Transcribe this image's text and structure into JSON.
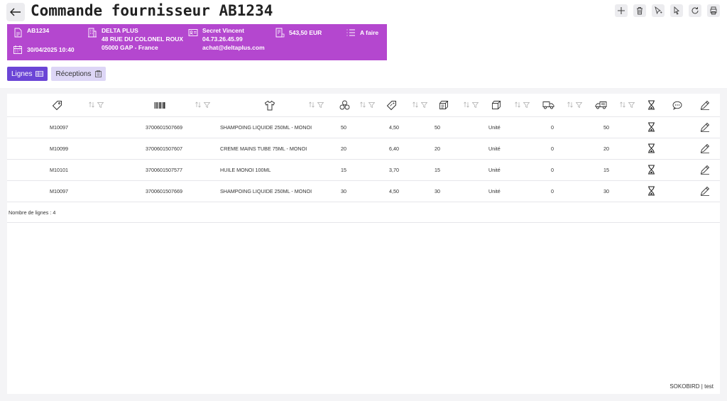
{
  "header": {
    "title": "Commande fournisseur AB1234",
    "back_icon": "arrow-left-icon",
    "toolbar": [
      "plus-icon",
      "trash-icon",
      "cursor-icon",
      "pointer-icon",
      "refresh-icon",
      "printer-icon"
    ]
  },
  "info": {
    "color": "#b447cf",
    "order_number": "AB1234",
    "order_date": "30/04/2025 10:40",
    "supplier_name": "DELTA PLUS",
    "supplier_address": "48 RUE DU COLONEL ROUX",
    "supplier_city": "05000 GAP - France",
    "contact_name": "Secret Vincent",
    "contact_phone": "04.73.26.45.99",
    "contact_email": "achat@deltaplus.com",
    "amount": "543,50 EUR",
    "status": "A faire"
  },
  "tabs": [
    {
      "label": "Lignes",
      "active": true
    },
    {
      "label": "Réceptions",
      "active": false
    }
  ],
  "table": {
    "columns": [
      "tag-icon",
      "barcode-icon",
      "shirt-icon",
      "boxes-icon",
      "price-tag-icon",
      "box-ordered-icon",
      "box-unit-icon",
      "truck-icon",
      "truck-remaining-icon",
      "hourglass-icon",
      "comment-icon",
      "edit-icon"
    ],
    "rows": [
      {
        "ref": "M10097",
        "ean": "3700601507669",
        "designation": "SHAMPOING LIQUIDE 250ML - MONOI",
        "qty": "50",
        "price": "4,50",
        "qty2": "50",
        "unit": "Unité",
        "received": "0",
        "remaining": "50"
      },
      {
        "ref": "M10099",
        "ean": "3700601507607",
        "designation": "CREME MAINS TUBE 75ML - MONOI",
        "qty": "20",
        "price": "6,40",
        "qty2": "20",
        "unit": "Unité",
        "received": "0",
        "remaining": "20"
      },
      {
        "ref": "M10101",
        "ean": "3700601507577",
        "designation": "HUILE MONOI 100ML",
        "qty": "15",
        "price": "3,70",
        "qty2": "15",
        "unit": "Unité",
        "received": "0",
        "remaining": "15"
      },
      {
        "ref": "M10097",
        "ean": "3700601507669",
        "designation": "SHAMPOING LIQUIDE 250ML - MONOI",
        "qty": "30",
        "price": "4,50",
        "qty2": "30",
        "unit": "Unité",
        "received": "0",
        "remaining": "30"
      }
    ],
    "row_count_label": "Nombre de lignes : 4"
  },
  "footer": {
    "brand": "SOKOBIRD | test"
  }
}
